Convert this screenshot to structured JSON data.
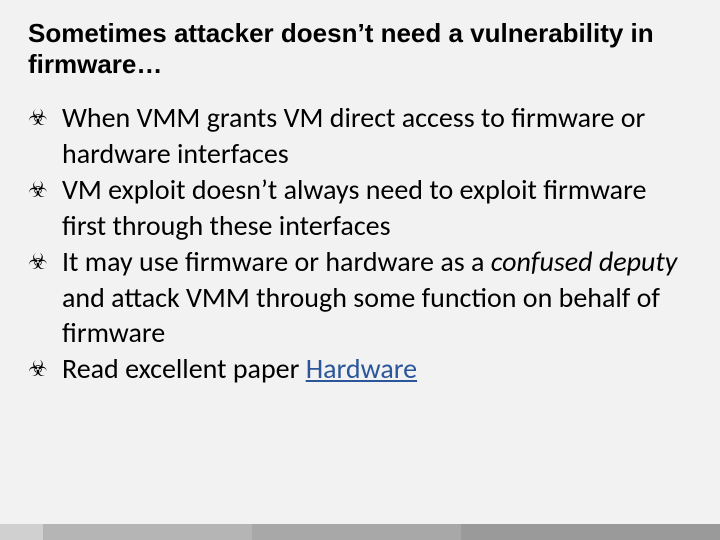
{
  "title": "Sometimes attacker doesn’t need a vulnerability in firmware…",
  "bullets": [
    {
      "pre": "When VMM grants VM direct access to firmware or hardware interfaces",
      "italic": "",
      "post": "",
      "link": ""
    },
    {
      "pre": "VM exploit doesn’t always need to exploit firmware first through these interfaces",
      "italic": "",
      "post": "",
      "link": ""
    },
    {
      "pre": "It may use firmware or hardware as a ",
      "italic": "confused deputy",
      "post": " and attack VMM through some function on behalf of firmware",
      "link": ""
    },
    {
      "pre": "Read excellent paper ",
      "italic": "",
      "post": "",
      "link": "Hardware"
    }
  ]
}
